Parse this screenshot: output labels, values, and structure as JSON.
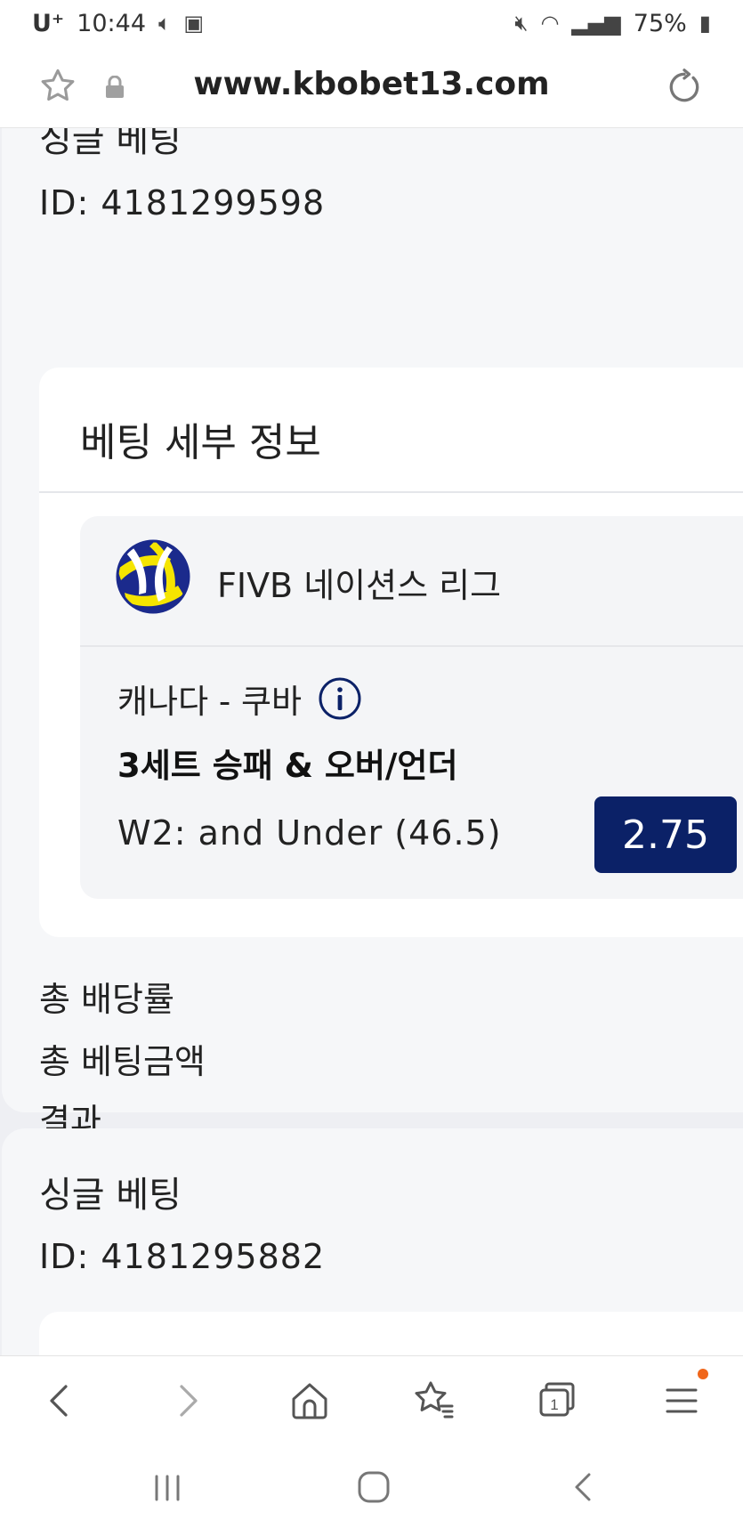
{
  "status_bar": {
    "carrier": "U⁺",
    "time": "10:44",
    "battery": "75%"
  },
  "browser": {
    "url": "www.kbobet13.com"
  },
  "bets": [
    {
      "type": "싱글 베팅",
      "id": "ID: 4181299598",
      "details_title": "베팅 세부 정보",
      "league": "FIVB 네이션스 리그",
      "match": "캐나다 - 쿠바",
      "market": "3세트 승패 & 오버/언더",
      "selection": "W2: and Under (46.5)",
      "odds": "2.75",
      "summary": {
        "total_odds_label": "총 배당률",
        "total_stake_label": "총 베팅금액",
        "result_label": "결과"
      }
    },
    {
      "type": "싱글 베팅",
      "id": "ID: 4181295882"
    }
  ],
  "icons": {
    "bookmark": "star-outline-icon",
    "lock": "lock-icon",
    "reload": "reload-icon",
    "info": "info-circle-icon",
    "league_logo": "volleyball-icon",
    "toolbar": [
      "back-arrow-icon",
      "forward-arrow-icon",
      "home-icon",
      "bookmarks-icon",
      "tabs-icon",
      "menu-icon"
    ],
    "tabs_count": "1"
  },
  "colors": {
    "odds_badge": "#0b2167",
    "info_icon": "#0b2167",
    "menu_dot": "#f0661a"
  }
}
